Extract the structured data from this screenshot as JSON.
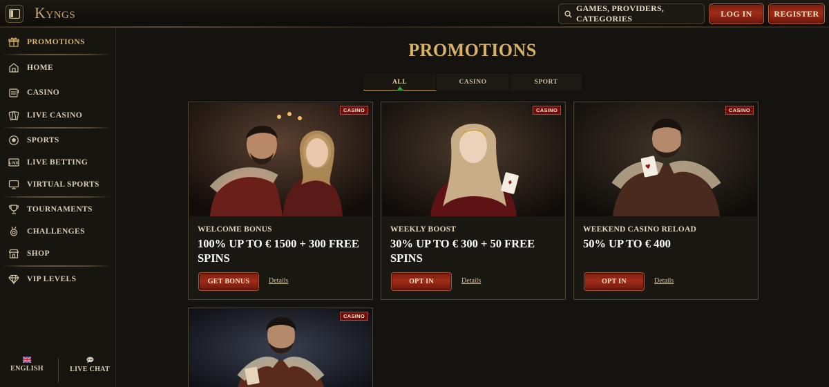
{
  "header": {
    "logo": "Kyngs",
    "search_label": "GAMES, PROVIDERS, CATEGORIES",
    "login_label": "LOG IN",
    "register_label": "REGISTER"
  },
  "sidebar": {
    "items": [
      {
        "label": "PROMOTIONS",
        "icon": "gift-icon",
        "active": true
      },
      {
        "label": "HOME",
        "icon": "home-icon"
      },
      {
        "label": "CASINO",
        "icon": "slot-machine-icon"
      },
      {
        "label": "LIVE CASINO",
        "icon": "cards-icon"
      },
      {
        "label": "SPORTS",
        "icon": "soccer-ball-icon"
      },
      {
        "label": "LIVE BETTING",
        "icon": "live-icon"
      },
      {
        "label": "VIRTUAL SPORTS",
        "icon": "monitor-icon"
      },
      {
        "label": "TOURNAMENTS",
        "icon": "trophy-icon"
      },
      {
        "label": "CHALLENGES",
        "icon": "medal-icon"
      },
      {
        "label": "SHOP",
        "icon": "shop-icon"
      },
      {
        "label": "VIP LEVELS",
        "icon": "diamond-icon"
      }
    ],
    "footer": {
      "language": "ENGLISH",
      "chat": "LIVE CHAT"
    }
  },
  "main": {
    "title": "PROMOTIONS",
    "tabs": [
      {
        "label": "ALL",
        "active": true
      },
      {
        "label": "CASINO"
      },
      {
        "label": "SPORT"
      }
    ],
    "cards": [
      {
        "badge": "CASINO",
        "subtitle": "WELCOME BONUS",
        "title": "100% UP TO € 1500 + 300 FREE SPINS",
        "button": "GET BONUS",
        "link": "Details"
      },
      {
        "badge": "CASINO",
        "subtitle": "WEEKLY BOOST",
        "title": "30% UP TO € 300 + 50 FREE SPINS",
        "button": "OPT IN",
        "link": "Details"
      },
      {
        "badge": "CASINO",
        "subtitle": "WEEKEND CASINO RELOAD",
        "title": "50% UP TO € 400",
        "button": "OPT IN",
        "link": "Details"
      },
      {
        "badge": "CASINO"
      }
    ]
  },
  "colors": {
    "accent_gold": "#d9b26a",
    "button_red": "#a02c16",
    "badge_red": "#6d0e0a",
    "background": "#15130f"
  }
}
